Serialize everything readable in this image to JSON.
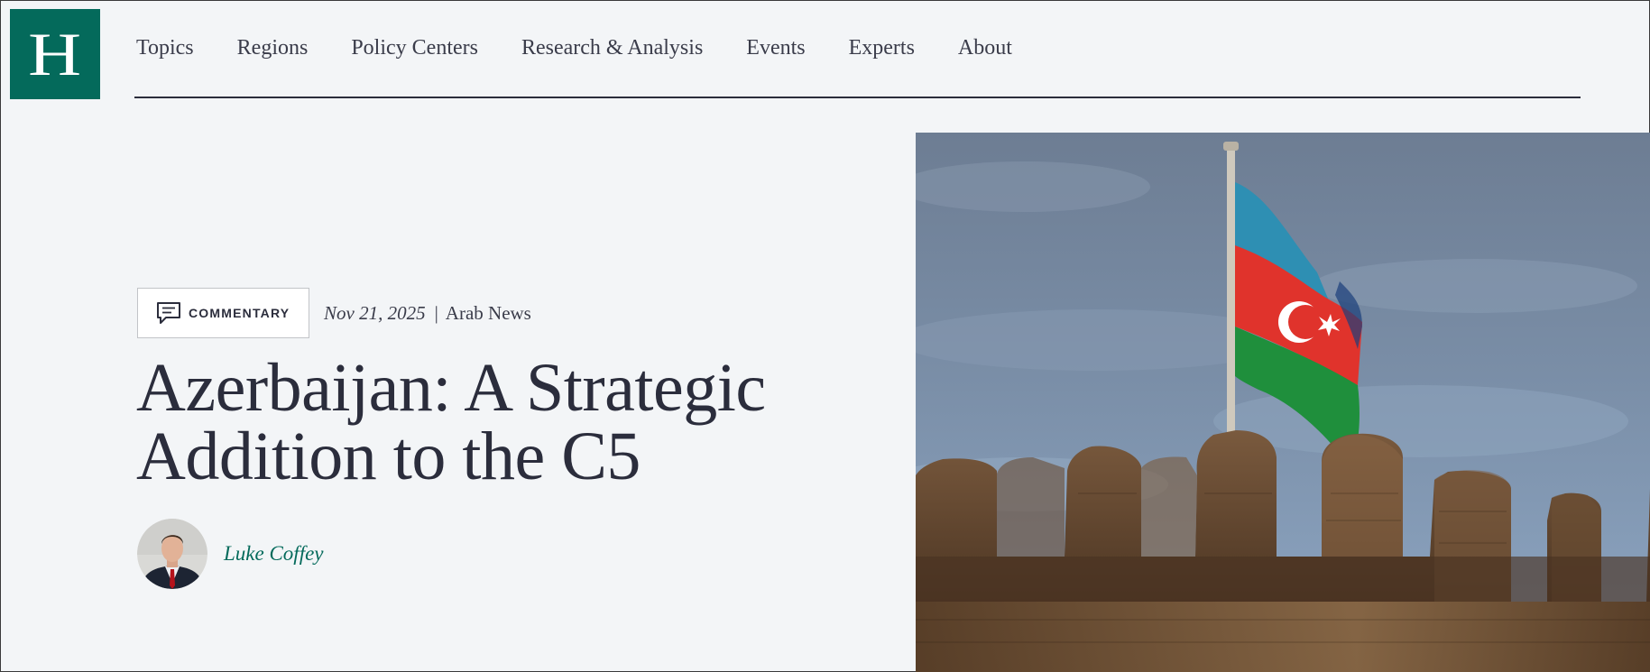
{
  "header": {
    "logo_letter": "H",
    "nav": [
      "Topics",
      "Regions",
      "Policy Centers",
      "Research & Analysis",
      "Events",
      "Experts",
      "About"
    ]
  },
  "article": {
    "type_label": "COMMENTARY",
    "date": "Nov 21, 2025",
    "separator": "|",
    "source": "Arab News",
    "title": "Azerbaijan: A Strategic Addition to the C5",
    "author": "Luke Coffey"
  },
  "icons": {
    "logo": "institution-logo",
    "badge": "speech-bubble-icon"
  },
  "colors": {
    "brand_green": "#046a5b",
    "text_dark": "#2b2d3c",
    "background": "#f3f5f7"
  }
}
